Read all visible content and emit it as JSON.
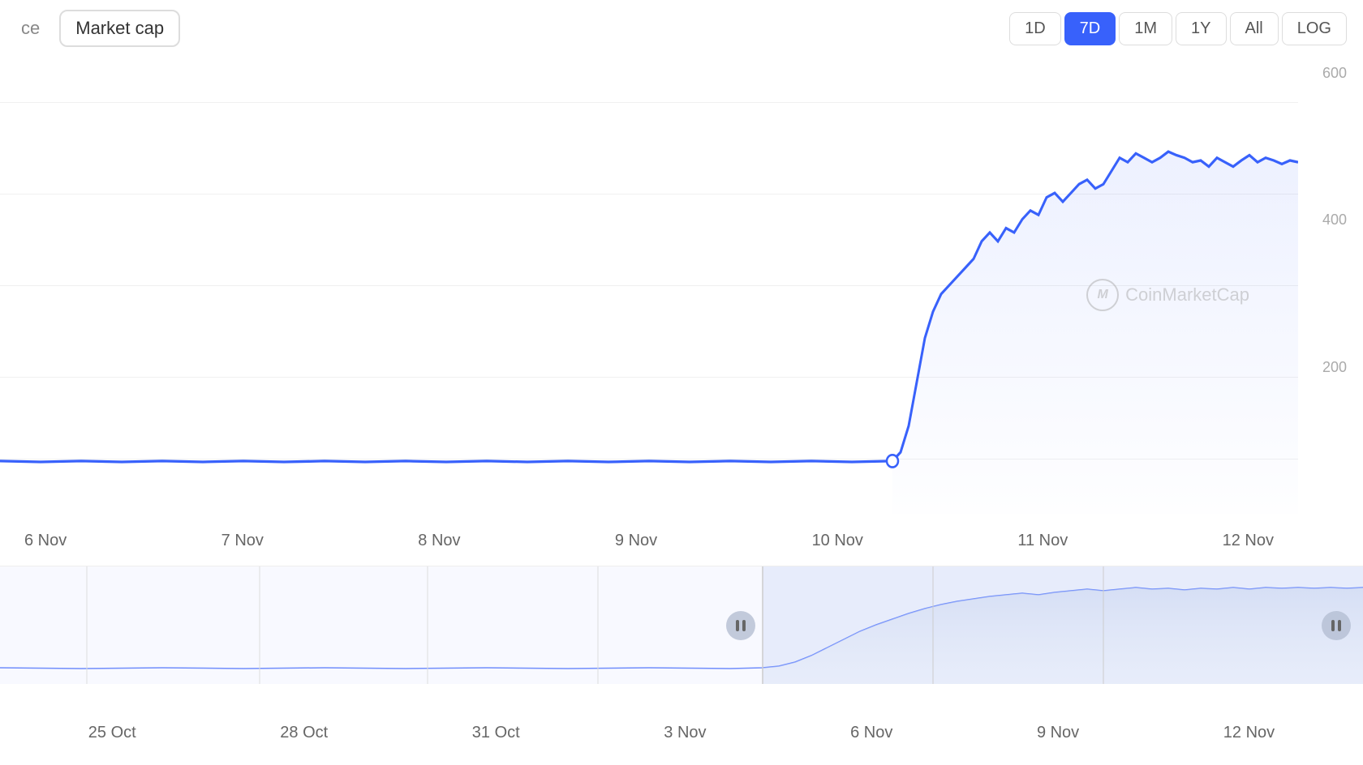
{
  "toolbar": {
    "tab_price_label": "ce",
    "tab_marketcap_label": "Market cap",
    "time_buttons": [
      {
        "label": "1D",
        "active": false
      },
      {
        "label": "7D",
        "active": true
      },
      {
        "label": "1M",
        "active": false
      },
      {
        "label": "1Y",
        "active": false
      },
      {
        "label": "All",
        "active": false
      },
      {
        "label": "LOG",
        "active": false
      }
    ]
  },
  "chart": {
    "y_labels": [
      "600",
      "400",
      "200"
    ],
    "x_labels_main": [
      "6 Nov",
      "7 Nov",
      "8 Nov",
      "9 Nov",
      "10 Nov",
      "11 Nov",
      "12 Nov"
    ],
    "watermark": "CoinMarketCap",
    "watermark_icon": "M"
  },
  "navigator": {
    "x_labels": [
      "25 Oct",
      "28 Oct",
      "31 Oct",
      "3 Nov",
      "6 Nov",
      "9 Nov",
      "12 Nov"
    ]
  }
}
